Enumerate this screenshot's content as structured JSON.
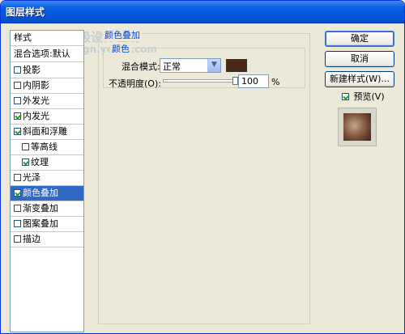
{
  "window": {
    "title": "图层样式"
  },
  "sidebar": {
    "header": "样式",
    "blend_options": "混合选项:默认",
    "items": [
      {
        "label": "投影",
        "checked": false,
        "sub": false,
        "selected": false
      },
      {
        "label": "内阴影",
        "checked": false,
        "sub": false,
        "selected": false
      },
      {
        "label": "外发光",
        "checked": false,
        "sub": false,
        "selected": false
      },
      {
        "label": "内发光",
        "checked": true,
        "sub": false,
        "selected": false
      },
      {
        "label": "斜面和浮雕",
        "checked": true,
        "sub": false,
        "selected": false
      },
      {
        "label": "等高线",
        "checked": false,
        "sub": true,
        "selected": false
      },
      {
        "label": "纹理",
        "checked": true,
        "sub": true,
        "selected": false
      },
      {
        "label": "光泽",
        "checked": false,
        "sub": false,
        "selected": false
      },
      {
        "label": "颜色叠加",
        "checked": true,
        "sub": false,
        "selected": true
      },
      {
        "label": "渐变叠加",
        "checked": false,
        "sub": false,
        "selected": false
      },
      {
        "label": "图案叠加",
        "checked": false,
        "sub": false,
        "selected": false
      },
      {
        "label": "描边",
        "checked": false,
        "sub": false,
        "selected": false
      }
    ]
  },
  "panel": {
    "group_title": "颜色叠加",
    "subgroup_title": "颜色",
    "blend_mode_label": "混合模式:",
    "blend_mode_value": "正常",
    "opacity_label": "不透明度(O):",
    "opacity_value": "100",
    "opacity_unit": "%",
    "opacity_level": 1.0,
    "color": "#4c2a1a"
  },
  "buttons": {
    "ok": "确定",
    "cancel": "取消",
    "new_style": "新建样式(W)...",
    "preview_label": "预览(V)",
    "preview_checked": true
  },
  "watermark": {
    "line1": "天极设计在线",
    "line2": "design.yesky.com"
  },
  "colors": {
    "accent": "#316ac5",
    "title_bar": "#0555d8",
    "group_label": "#0046d5"
  }
}
